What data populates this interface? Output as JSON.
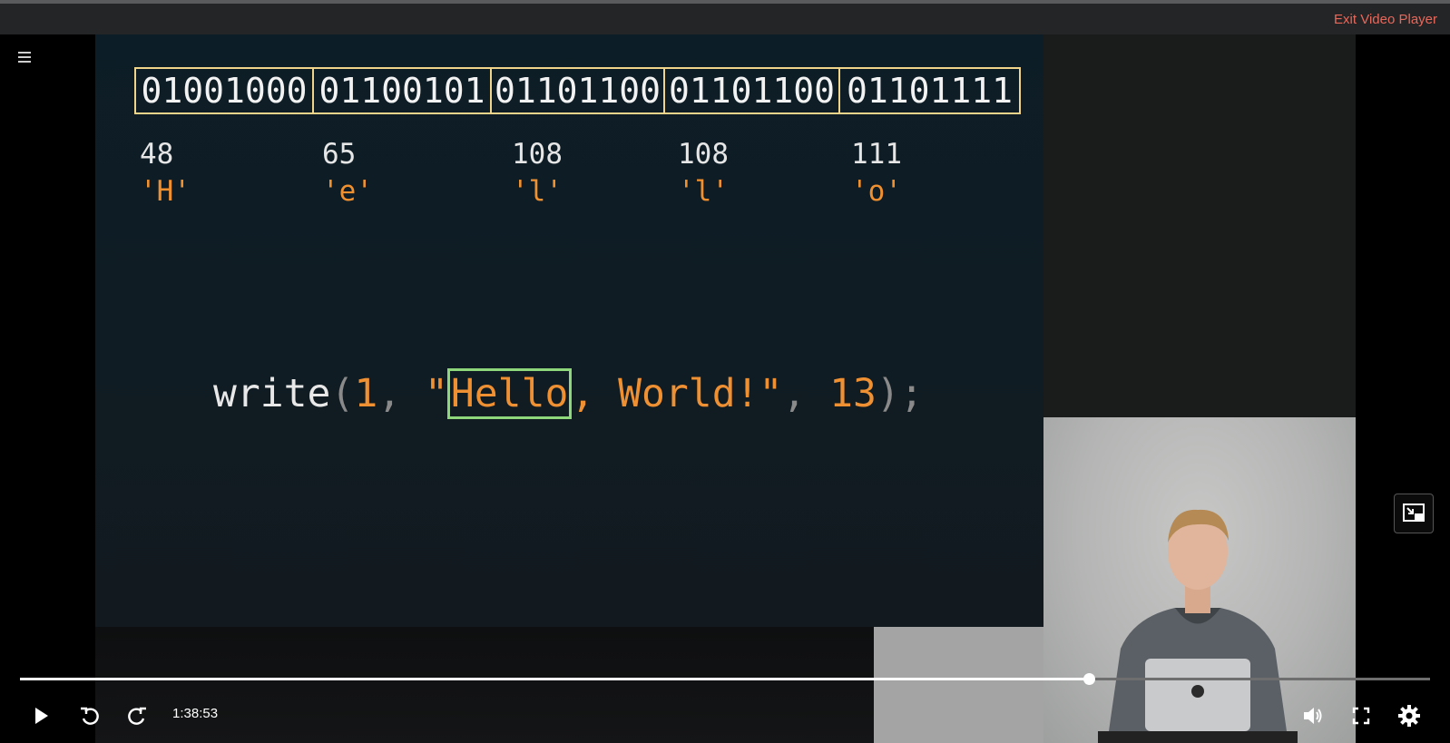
{
  "header": {
    "exit_label": "Exit Video Player"
  },
  "slide": {
    "bytes": [
      {
        "bits": "01001000",
        "decimal": "48",
        "char": "'H'"
      },
      {
        "bits": "01100101",
        "decimal": "65",
        "char": "'e'"
      },
      {
        "bits": "01101100",
        "decimal": "108",
        "char": "'l'"
      },
      {
        "bits": "01101100",
        "decimal": "108",
        "char": "'l'"
      },
      {
        "bits": "01101111",
        "decimal": "111",
        "char": "'o'"
      }
    ],
    "code": {
      "fn": "write",
      "open_paren": "(",
      "arg1": "1",
      "comma1": ", ",
      "quote_open": "\"",
      "highlight": "Hello",
      "rest_string": ", World!\"",
      "comma2": ", ",
      "arg3": "13",
      "close": ");"
    }
  },
  "player": {
    "time": "1:38:53",
    "progress": 0.758,
    "accent_color": "#ffffff",
    "icons": {
      "play": "play-icon",
      "rewind": "rewind-icon",
      "forward": "forward-icon",
      "volume": "volume-icon",
      "fullscreen": "fullscreen-icon",
      "settings": "settings-icon",
      "pip": "picture-in-picture-icon",
      "menu": "menu-icon"
    }
  }
}
